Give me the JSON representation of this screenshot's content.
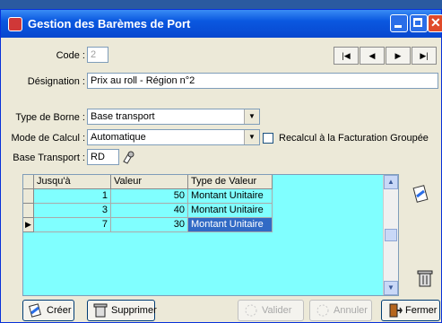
{
  "window": {
    "title": "Gestion des Barèmes de Port"
  },
  "navigation": {
    "first_icon": "first-record-icon",
    "prev_icon": "previous-record-icon",
    "next_icon": "next-record-icon",
    "last_icon": "last-record-icon"
  },
  "form": {
    "code_label": "Code :",
    "code_value": "2",
    "designation_label": "Désignation :",
    "designation_value": "Prix au roll - Région n°2",
    "type_borne_label": "Type de Borne :",
    "type_borne_value": "Base transport",
    "mode_calcul_label": "Mode de Calcul :",
    "mode_calcul_value": "Automatique",
    "recalcul_label": "Recalcul à la Facturation Groupée",
    "recalcul_checked": false,
    "base_transport_label": "Base Transport :",
    "base_transport_value": "RD"
  },
  "grid": {
    "columns": [
      "Jusqu'à",
      "Valeur",
      "Type de Valeur"
    ],
    "rows": [
      {
        "jusqua": "1",
        "valeur": "50",
        "type": "Montant Unitaire"
      },
      {
        "jusqua": "3",
        "valeur": "40",
        "type": "Montant Unitaire"
      },
      {
        "jusqua": "7",
        "valeur": "30",
        "type": "Montant Unitaire"
      }
    ],
    "selected_row": 2
  },
  "buttons": {
    "create": "Créer",
    "delete": "Supprimer",
    "validate": "Valider",
    "cancel": "Annuler",
    "close": "Fermer"
  },
  "colors": {
    "grid_background": "#80ffff",
    "selection": "#316ac5",
    "title_bar": "#0a58e0"
  }
}
